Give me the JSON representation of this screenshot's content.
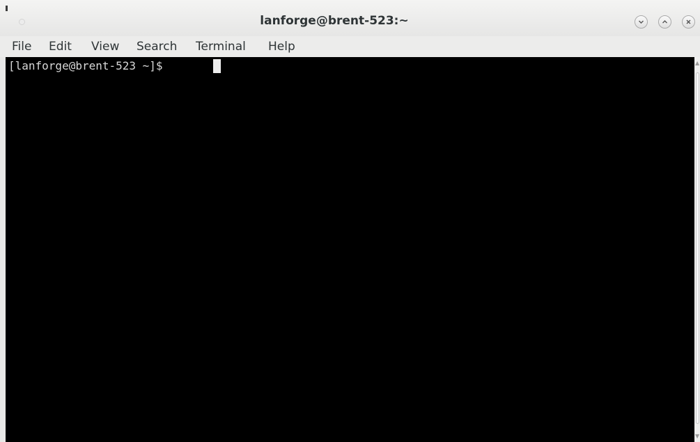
{
  "window": {
    "title": "lanforge@brent-523:~"
  },
  "menubar": {
    "items": [
      "File",
      "Edit",
      "View",
      "Search",
      "Terminal",
      "Help"
    ]
  },
  "terminal": {
    "prompt": "[lanforge@brent-523 ~]$ ",
    "background": "#000000",
    "foreground": "#d8d8d8"
  },
  "window_buttons": {
    "minimize": "chevron-down-icon",
    "maximize": "chevron-up-icon",
    "close": "close-icon"
  },
  "scrollbar": {
    "up_arrow": "▲",
    "down_arrow": "▼"
  }
}
